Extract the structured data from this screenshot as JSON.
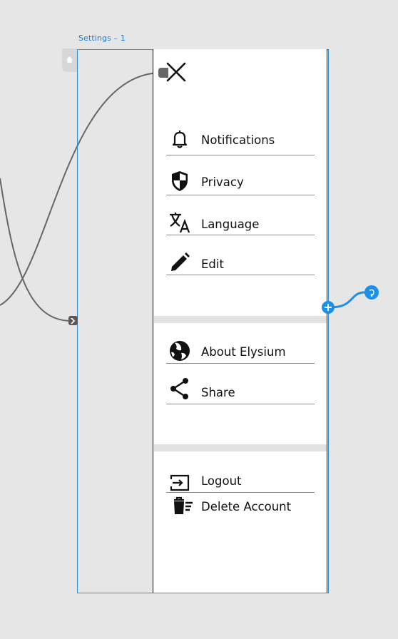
{
  "canvas": {
    "artboard_label": "Settings – 1"
  },
  "menu": {
    "close_icon": "close-icon",
    "section1": [
      {
        "id": "notifications",
        "label": "Notifications",
        "icon": "bell-icon"
      },
      {
        "id": "privacy",
        "label": "Privacy",
        "icon": "shield-icon"
      },
      {
        "id": "language",
        "label": "Language",
        "icon": "translate-icon"
      },
      {
        "id": "edit",
        "label": "Edit",
        "icon": "pencil-icon"
      }
    ],
    "section2": [
      {
        "id": "about",
        "label": "About Elysium",
        "icon": "globe-icon"
      },
      {
        "id": "share",
        "label": "Share",
        "icon": "share-icon"
      }
    ],
    "section3": [
      {
        "id": "logout",
        "label": "Logout",
        "icon": "logout-icon"
      },
      {
        "id": "delete",
        "label": "Delete Account",
        "icon": "delete-list-icon"
      }
    ]
  },
  "colors": {
    "accent": "#1c8fe8",
    "artboard_border": "#2f8fe3",
    "wire": "#666666",
    "divider": "#e2e2e2"
  }
}
